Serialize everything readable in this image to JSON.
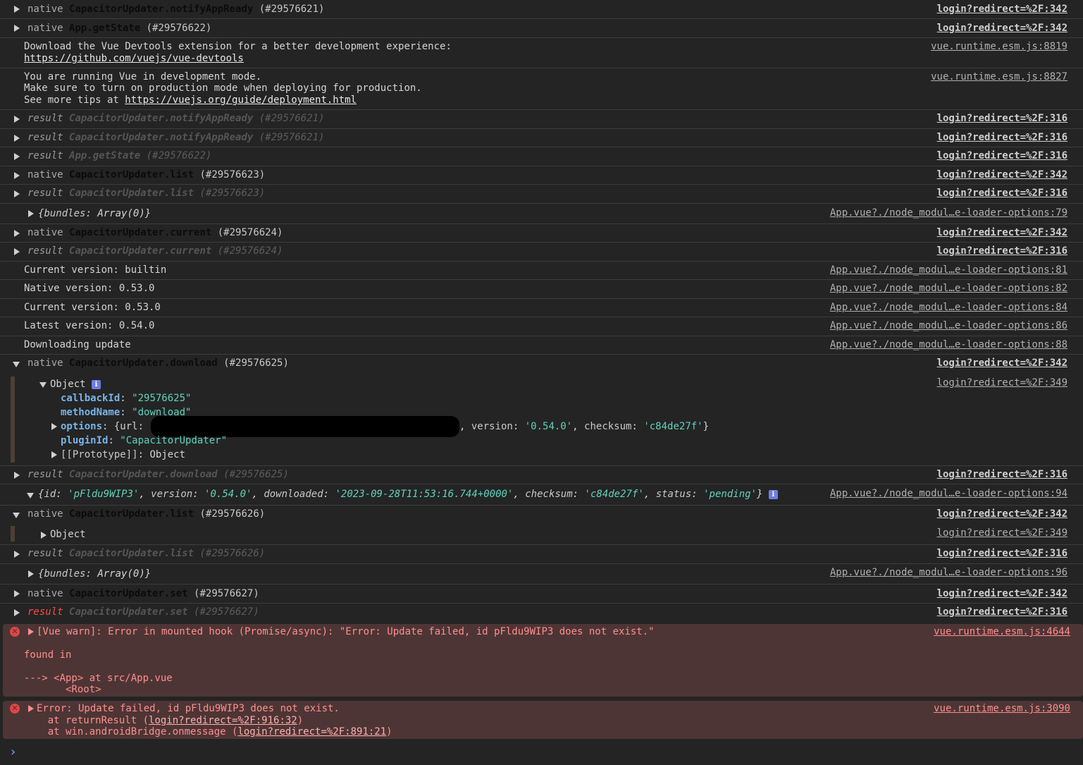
{
  "console": {
    "messages": [
      {
        "kind": "native",
        "method": "CapacitorUpdater.notifyAppReady",
        "id": "(#29576621)",
        "source": "login?redirect=%2F:342"
      },
      {
        "kind": "native",
        "method": "App.getState",
        "id": "(#29576622)",
        "source": "login?redirect=%2F:342"
      },
      {
        "kind": "log",
        "lines": [
          "Download the Vue Devtools extension for a better development experience:"
        ],
        "link": "https://github.com/vuejs/vue-devtools",
        "source": "vue.runtime.esm.js:8819"
      },
      {
        "kind": "log",
        "lines": [
          "You are running Vue in development mode.",
          "Make sure to turn on production mode when deploying for production.",
          "See more tips at "
        ],
        "link": "https://vuejs.org/guide/deployment.html",
        "source": "vue.runtime.esm.js:8827"
      },
      {
        "kind": "result",
        "method": "CapacitorUpdater.notifyAppReady",
        "id": "(#29576621)",
        "source": "login?redirect=%2F:316"
      },
      {
        "kind": "result",
        "method": "CapacitorUpdater.notifyAppReady",
        "id": "(#29576621)",
        "source": "login?redirect=%2F:316"
      },
      {
        "kind": "result",
        "method": "App.getState",
        "id": "(#29576622)",
        "source": "login?redirect=%2F:316"
      },
      {
        "kind": "native",
        "method": "CapacitorUpdater.list",
        "id": "(#29576623)",
        "source": "login?redirect=%2F:342"
      },
      {
        "kind": "result",
        "method": "CapacitorUpdater.list",
        "id": "(#29576623)",
        "source": "login?redirect=%2F:316"
      },
      {
        "kind": "object",
        "text_open": "{",
        "key": "bundles",
        "value": "Array(0)",
        "text_close": "}",
        "source": "App.vue?./node_modul…e-loader-options:79"
      },
      {
        "kind": "native",
        "method": "CapacitorUpdater.current",
        "id": "(#29576624)",
        "source": "login?redirect=%2F:342"
      },
      {
        "kind": "result",
        "method": "CapacitorUpdater.current",
        "id": "(#29576624)",
        "source": "login?redirect=%2F:316"
      },
      {
        "kind": "log",
        "text": "Current version: builtin",
        "source": "App.vue?./node_modul…e-loader-options:81"
      },
      {
        "kind": "log",
        "text": "Native version: 0.53.0",
        "source": "App.vue?./node_modul…e-loader-options:82"
      },
      {
        "kind": "log",
        "text": "Current version: 0.53.0",
        "source": "App.vue?./node_modul…e-loader-options:84"
      },
      {
        "kind": "log",
        "text": "Latest version: 0.54.0",
        "source": "App.vue?./node_modul…e-loader-options:86"
      },
      {
        "kind": "log",
        "text": "Downloading update",
        "source": "App.vue?./node_modul…e-loader-options:88"
      },
      {
        "kind": "native",
        "method": "CapacitorUpdater.download",
        "id": "(#29576625)",
        "source": "login?redirect=%2F:342",
        "expanded": true
      },
      {
        "kind": "group-object",
        "label": "Object",
        "source": "login?redirect=%2F:349",
        "props": {
          "callbackId": {
            "key": "callbackId",
            "value": "\"29576625\""
          },
          "methodName": {
            "key": "methodName",
            "value": "\"download\""
          },
          "options": {
            "key": "options",
            "prefix": "{url: ",
            "version_key": "version",
            "version_val": "'0.54.0'",
            "checksum_key": "checksum",
            "checksum_val": "'c84de27f'",
            "suffix": "}"
          },
          "pluginId": {
            "key": "pluginId",
            "value": "\"CapacitorUpdater\""
          },
          "prototype": {
            "key": "[[Prototype]]",
            "value": "Object"
          }
        }
      },
      {
        "kind": "result",
        "method": "CapacitorUpdater.download",
        "id": "(#29576625)",
        "source": "login?redirect=%2F:316"
      },
      {
        "kind": "object",
        "source": "App.vue?./node_modul…e-loader-options:94",
        "fields": [
          {
            "key": "id",
            "value": "'pFldu9WIP3'"
          },
          {
            "key": "version",
            "value": "'0.54.0'"
          },
          {
            "key": "downloaded",
            "value": "'2023-09-28T11:53:16.744+0000'"
          },
          {
            "key": "checksum",
            "value": "'c84de27f'"
          },
          {
            "key": "status",
            "value": "'pending'"
          }
        ]
      },
      {
        "kind": "native",
        "method": "CapacitorUpdater.list",
        "id": "(#29576626)",
        "source": "login?redirect=%2F:342",
        "expanded": true
      },
      {
        "kind": "group-object",
        "label": "Object",
        "source": "login?redirect=%2F:349"
      },
      {
        "kind": "result",
        "method": "CapacitorUpdater.list",
        "id": "(#29576626)",
        "source": "login?redirect=%2F:316"
      },
      {
        "kind": "object",
        "key": "bundles",
        "value": "Array(0)",
        "source": "App.vue?./node_modul…e-loader-options:96"
      },
      {
        "kind": "native",
        "method": "CapacitorUpdater.set",
        "id": "(#29576627)",
        "source": "login?redirect=%2F:342"
      },
      {
        "kind": "result",
        "method": "CapacitorUpdater.set",
        "id": "(#29576627)",
        "source": "login?redirect=%2F:316"
      }
    ],
    "labels": {
      "native": "native",
      "result": "result"
    },
    "errors": [
      {
        "text": "[Vue warn]: Error in mounted hook (Promise/async): \"Error: Update failed, id pFldu9WIP3 does not exist.\"",
        "found_in": "found in",
        "trace1": "---> <App> at src/App.vue",
        "trace2": "       <Root>",
        "source": "vue.runtime.esm.js:4644"
      },
      {
        "text": "Error: Update failed, id pFldu9WIP3 does not exist.",
        "at1_prefix": "    at returnResult (",
        "at1_link": "login?redirect=%2F:916:32",
        "at1_suffix": ")",
        "at2_prefix": "    at win.androidBridge.onmessage (",
        "at2_link": "login?redirect=%2F:891:21",
        "at2_suffix": ")",
        "source": "vue.runtime.esm.js:3090"
      }
    ],
    "prompt": "›",
    "colors": {
      "background": "#242424",
      "error_bg": "#4e3535",
      "error_text": "#ff8e8e",
      "string": "#5fd3be",
      "key": "#78b4e8"
    }
  }
}
